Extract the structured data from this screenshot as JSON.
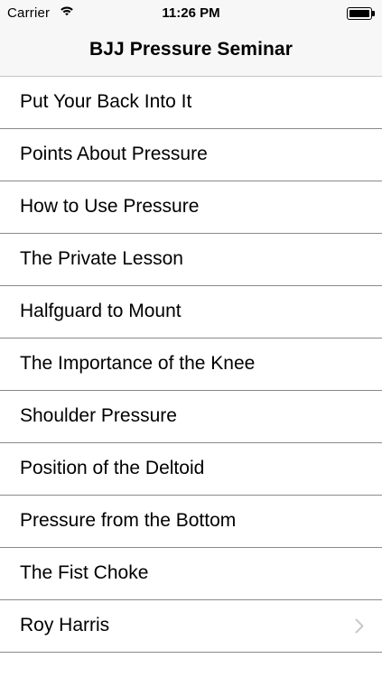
{
  "status_bar": {
    "carrier": "Carrier",
    "time": "11:26 PM",
    "wifi_icon": "wifi-icon",
    "battery_icon": "battery-icon",
    "battery_level": 1.0
  },
  "nav": {
    "title": "BJJ Pressure Seminar"
  },
  "list": {
    "items": [
      {
        "label": "Put Your Back Into It"
      },
      {
        "label": "Points About Pressure"
      },
      {
        "label": "How to Use Pressure"
      },
      {
        "label": "The Private Lesson"
      },
      {
        "label": "Halfguard to Mount"
      },
      {
        "label": "The Importance of the Knee"
      },
      {
        "label": "Shoulder Pressure"
      },
      {
        "label": "Position of the Deltoid"
      },
      {
        "label": "Pressure from the Bottom"
      },
      {
        "label": "The Fist Choke"
      },
      {
        "label": "Roy Harris",
        "accessory": "chevron-right-icon"
      }
    ]
  },
  "colors": {
    "nav_background": "#f7f7f7",
    "separator": "#8a8a8a",
    "chevron": "#c7c7cc",
    "text": "#000000"
  }
}
